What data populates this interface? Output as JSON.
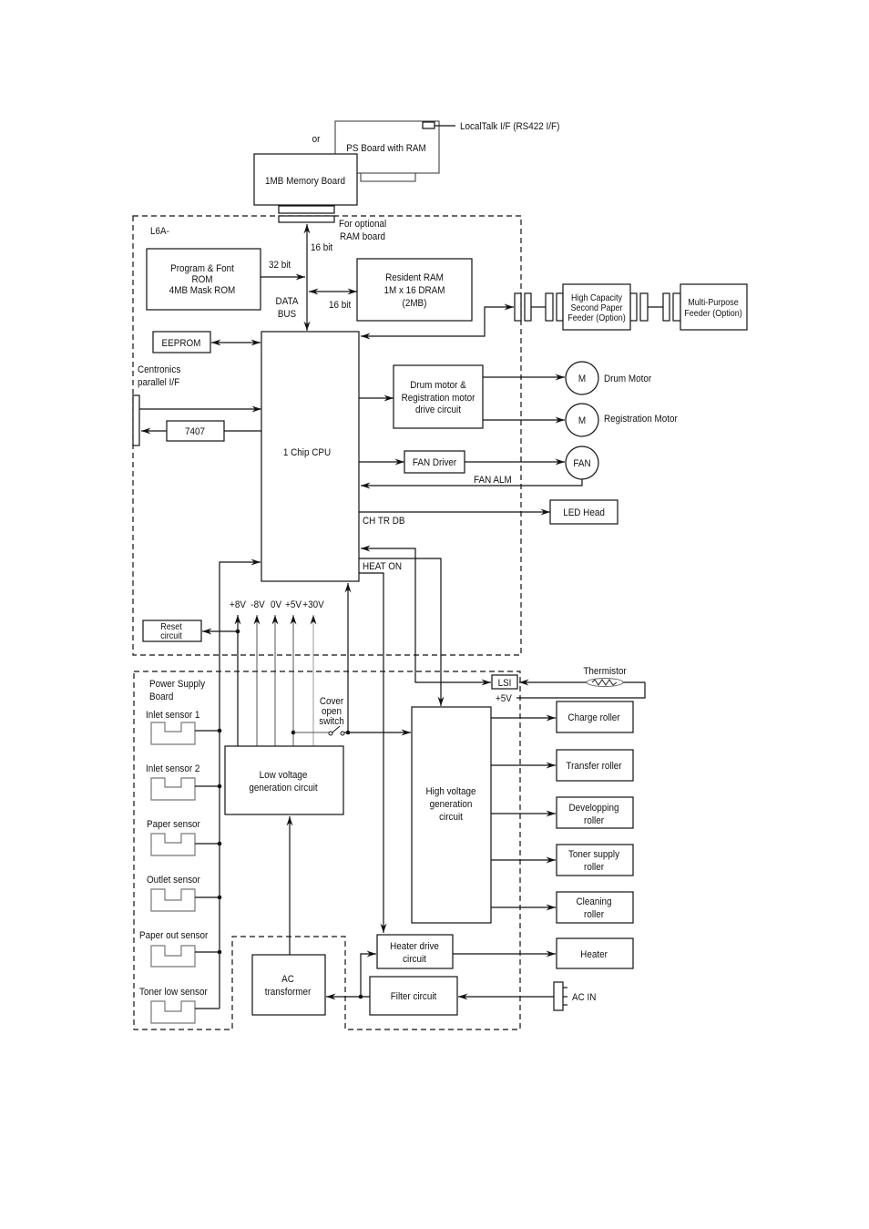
{
  "memory": {
    "or_label": "or",
    "ps_board": "PS Board with RAM",
    "localtalk": "LocalTalk I/F (RS422 I/F)",
    "memory_board": "1MB Memory Board",
    "optional_ram": [
      "For optional",
      "RAM board"
    ]
  },
  "controller": {
    "label": "L6A-",
    "rom": [
      "Program & Font",
      "ROM",
      "4MB Mask ROM"
    ],
    "bus_32": "32 bit",
    "bus_16_top": "16 bit",
    "data_bus": [
      "DATA",
      "BUS"
    ],
    "bus_16_ram": "16 bit",
    "ram": [
      "Resident RAM",
      "1M x 16 DRAM",
      "(2MB)"
    ],
    "eeprom": "EEPROM",
    "centronics": [
      "Centronics",
      "parallel I/F"
    ],
    "driver_7407": "7407",
    "cpu": "1 Chip CPU",
    "motor_drive": [
      "Drum motor &",
      "Registration motor",
      "drive circuit"
    ],
    "fan_driver": "FAN Driver",
    "fan_alm": "FAN ALM",
    "ch_tr_db": "CH TR DB",
    "heat_on": "HEAT ON",
    "voltages": [
      "+8V",
      "-8V",
      "0V",
      "+5V",
      "+30V"
    ],
    "reset": [
      "Reset",
      "circuit"
    ]
  },
  "external": {
    "hc_feeder": [
      "High Capacity",
      "Second Paper",
      "Feeder (Option)"
    ],
    "mp_feeder": [
      "Multi-Purpose",
      "Feeder (Option)"
    ],
    "drum_motor": {
      "symbol": "M",
      "label": "Drum Motor"
    },
    "registration_motor": {
      "symbol": "M",
      "label": "Registration Motor"
    },
    "fan": "FAN",
    "led_head": "LED Head",
    "thermistor": "Thermistor",
    "rollers": [
      [
        "Charge roller"
      ],
      [
        "Transfer roller"
      ],
      [
        "Developping",
        "roller"
      ],
      [
        "Toner supply",
        "roller"
      ],
      [
        "Cleaning",
        "roller"
      ]
    ],
    "heater": "Heater",
    "ac_in": "AC IN"
  },
  "power_supply": {
    "label": [
      "Power Supply",
      "Board"
    ],
    "sensors": [
      "Inlet sensor 1",
      "Inlet sensor 2",
      "Paper sensor",
      "Outlet sensor",
      "Paper out sensor",
      "Toner low sensor"
    ],
    "cover_switch": [
      "Cover",
      "open",
      "switch"
    ],
    "low_voltage": [
      "Low voltage",
      "generation circuit"
    ],
    "high_voltage": [
      "High voltage",
      "generation",
      "circuit"
    ],
    "lsi": "LSI",
    "plus5v": "+5V",
    "heater_drive": [
      "Heater drive",
      "circuit"
    ],
    "filter": "Filter circuit",
    "ac_transformer": [
      "AC",
      "transformer"
    ]
  }
}
